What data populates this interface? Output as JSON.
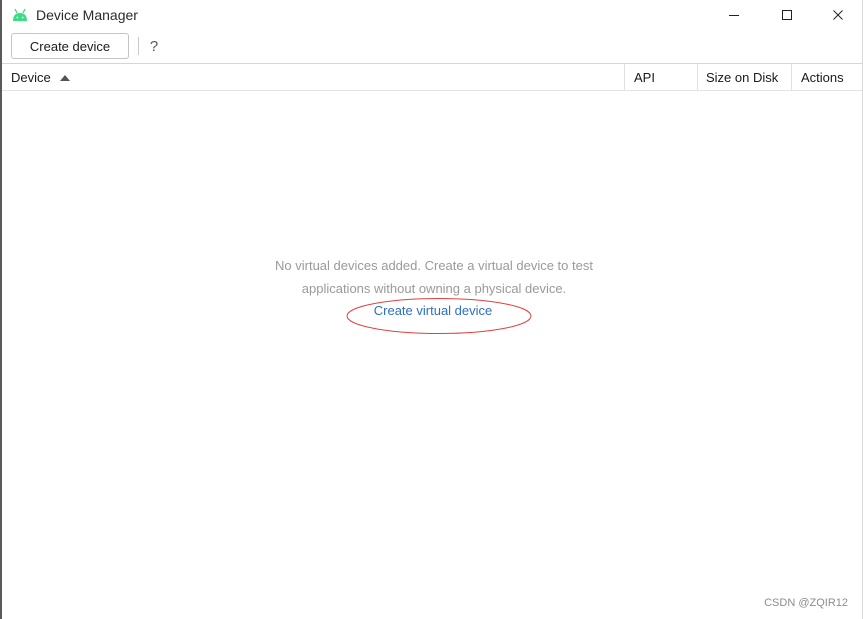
{
  "window": {
    "title": "Device Manager",
    "app_icon": "android-icon",
    "controls": {
      "minimize": "minimize-icon",
      "maximize": "maximize-icon",
      "close": "close-icon"
    }
  },
  "toolbar": {
    "create_label": "Create device",
    "help_label": "?"
  },
  "table": {
    "columns": [
      "Device",
      "API",
      "Size on Disk",
      "Actions"
    ],
    "sort_column": "Device",
    "sort_direction": "ascending"
  },
  "empty_state": {
    "line1": "No virtual devices added. Create a virtual device to test",
    "line2": "applications without owning a physical device.",
    "link_label": "Create virtual device"
  },
  "watermark": "CSDN @ZQIR12",
  "colors": {
    "link": "#2f6fc2",
    "annotation": "#e04040",
    "android_green": "#3ddc84"
  }
}
